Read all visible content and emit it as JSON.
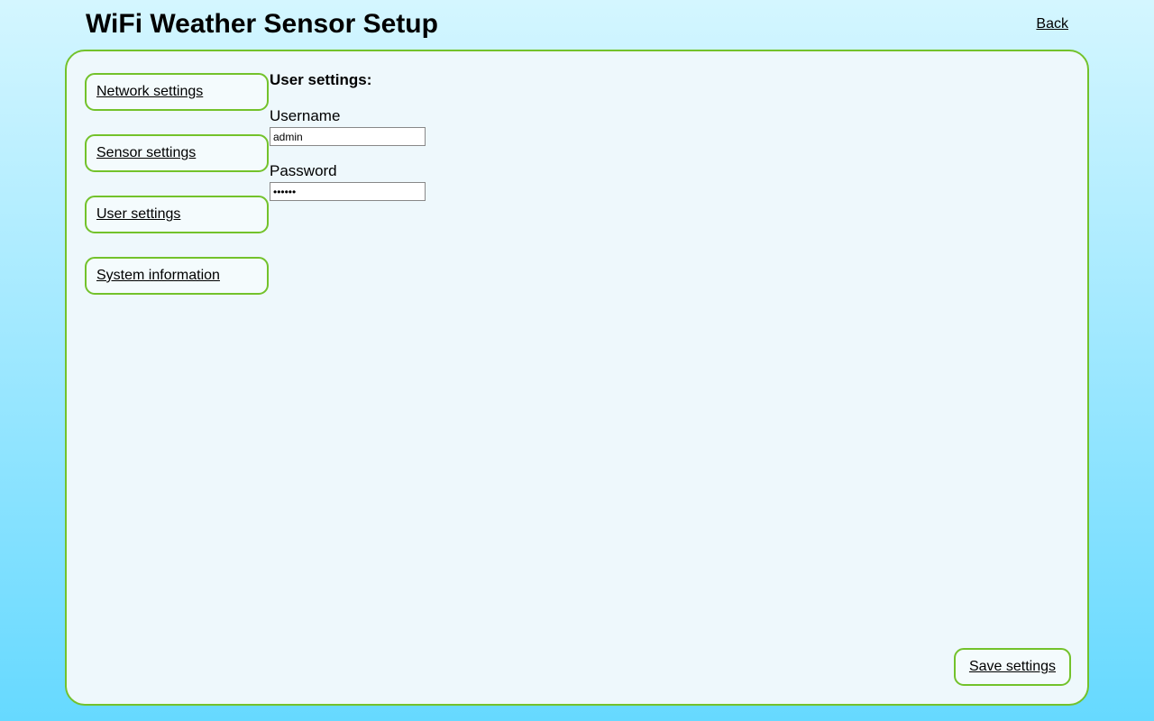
{
  "header": {
    "title": "WiFi Weather Sensor Setup",
    "back_label": "Back"
  },
  "sidebar": {
    "items": [
      {
        "label": "Network settings"
      },
      {
        "label": "Sensor settings"
      },
      {
        "label": "User settings"
      },
      {
        "label": "System information"
      }
    ]
  },
  "main": {
    "heading": "User settings:",
    "username_label": "Username",
    "username_value": "admin",
    "password_label": "Password",
    "password_value": "••••••",
    "save_label": "Save settings"
  }
}
